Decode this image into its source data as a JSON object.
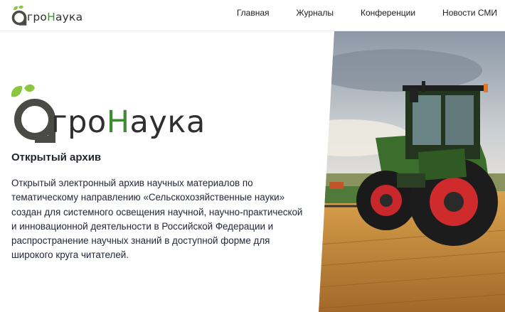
{
  "header": {
    "logo_prefix": "гро",
    "logo_highlight": "Н",
    "logo_suffix": "аука",
    "nav": [
      {
        "label": "Главная"
      },
      {
        "label": "Журналы"
      },
      {
        "label": "Конференции"
      },
      {
        "label": "Новости СМИ"
      }
    ]
  },
  "main": {
    "logo_prefix": "гро",
    "logo_highlight": "Н",
    "logo_suffix": "аука",
    "subtitle": "Открытый архив",
    "description": "Открытый электронный архив научных материалов по тематическому направлению «Сельскохозяйственные науки» создан для системного освещения научной, научно-практической и инновационной деятельности в Российской Федерации и распространение научных знаний в доступной форме для широкого круга читателей."
  },
  "colors": {
    "brand_green": "#3e8b33",
    "leaf_green": "#8cc63f",
    "text_dark": "#1f2430"
  }
}
